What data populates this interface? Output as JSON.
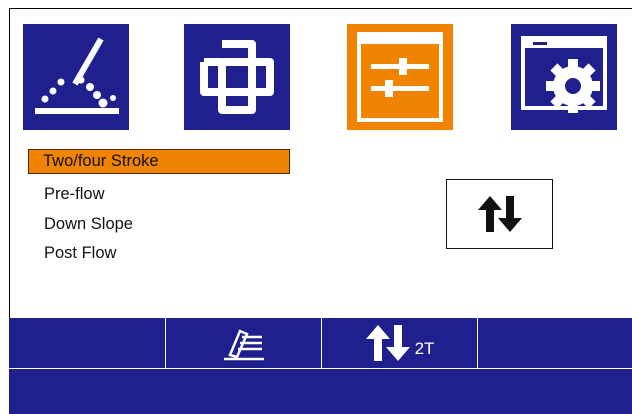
{
  "tabs": [
    {
      "id": "weld",
      "icon": "welding-torch-icon",
      "active": false
    },
    {
      "id": "link",
      "icon": "chain-link-icon",
      "active": false
    },
    {
      "id": "params",
      "icon": "sliders-icon",
      "active": true
    },
    {
      "id": "settings",
      "icon": "window-gear-icon",
      "active": false
    }
  ],
  "menu": {
    "items": [
      "Two/four Stroke",
      "Pre-flow",
      "Down Slope",
      "Post  Flow"
    ],
    "selected_index": 0
  },
  "softkeys": {
    "key2_icon": "weld-process-icon",
    "key3_icon": "up-down-arrows-icon",
    "key3_label": "2T"
  },
  "colors": {
    "panel_blue": "#1f1f8e",
    "highlight_orange": "#f08400",
    "background": "#ffffff"
  }
}
